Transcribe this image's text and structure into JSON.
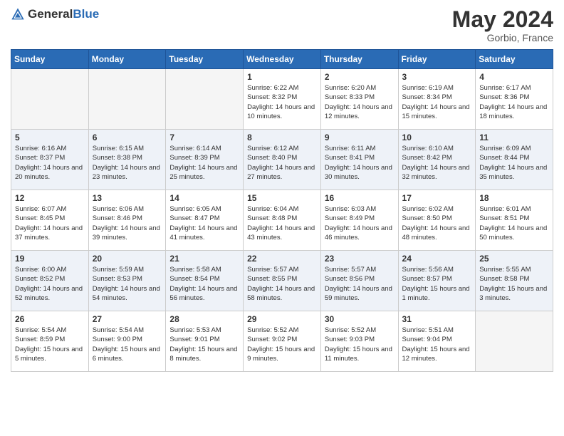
{
  "header": {
    "logo_general": "General",
    "logo_blue": "Blue",
    "month_year": "May 2024",
    "location": "Gorbio, France"
  },
  "days_of_week": [
    "Sunday",
    "Monday",
    "Tuesday",
    "Wednesday",
    "Thursday",
    "Friday",
    "Saturday"
  ],
  "weeks": [
    [
      {
        "day": "",
        "empty": true
      },
      {
        "day": "",
        "empty": true
      },
      {
        "day": "",
        "empty": true
      },
      {
        "day": "1",
        "sunrise": "6:22 AM",
        "sunset": "8:32 PM",
        "daylight": "14 hours and 10 minutes."
      },
      {
        "day": "2",
        "sunrise": "6:20 AM",
        "sunset": "8:33 PM",
        "daylight": "14 hours and 12 minutes."
      },
      {
        "day": "3",
        "sunrise": "6:19 AM",
        "sunset": "8:34 PM",
        "daylight": "14 hours and 15 minutes."
      },
      {
        "day": "4",
        "sunrise": "6:17 AM",
        "sunset": "8:36 PM",
        "daylight": "14 hours and 18 minutes."
      }
    ],
    [
      {
        "day": "5",
        "sunrise": "6:16 AM",
        "sunset": "8:37 PM",
        "daylight": "14 hours and 20 minutes."
      },
      {
        "day": "6",
        "sunrise": "6:15 AM",
        "sunset": "8:38 PM",
        "daylight": "14 hours and 23 minutes."
      },
      {
        "day": "7",
        "sunrise": "6:14 AM",
        "sunset": "8:39 PM",
        "daylight": "14 hours and 25 minutes."
      },
      {
        "day": "8",
        "sunrise": "6:12 AM",
        "sunset": "8:40 PM",
        "daylight": "14 hours and 27 minutes."
      },
      {
        "day": "9",
        "sunrise": "6:11 AM",
        "sunset": "8:41 PM",
        "daylight": "14 hours and 30 minutes."
      },
      {
        "day": "10",
        "sunrise": "6:10 AM",
        "sunset": "8:42 PM",
        "daylight": "14 hours and 32 minutes."
      },
      {
        "day": "11",
        "sunrise": "6:09 AM",
        "sunset": "8:44 PM",
        "daylight": "14 hours and 35 minutes."
      }
    ],
    [
      {
        "day": "12",
        "sunrise": "6:07 AM",
        "sunset": "8:45 PM",
        "daylight": "14 hours and 37 minutes."
      },
      {
        "day": "13",
        "sunrise": "6:06 AM",
        "sunset": "8:46 PM",
        "daylight": "14 hours and 39 minutes."
      },
      {
        "day": "14",
        "sunrise": "6:05 AM",
        "sunset": "8:47 PM",
        "daylight": "14 hours and 41 minutes."
      },
      {
        "day": "15",
        "sunrise": "6:04 AM",
        "sunset": "8:48 PM",
        "daylight": "14 hours and 43 minutes."
      },
      {
        "day": "16",
        "sunrise": "6:03 AM",
        "sunset": "8:49 PM",
        "daylight": "14 hours and 46 minutes."
      },
      {
        "day": "17",
        "sunrise": "6:02 AM",
        "sunset": "8:50 PM",
        "daylight": "14 hours and 48 minutes."
      },
      {
        "day": "18",
        "sunrise": "6:01 AM",
        "sunset": "8:51 PM",
        "daylight": "14 hours and 50 minutes."
      }
    ],
    [
      {
        "day": "19",
        "sunrise": "6:00 AM",
        "sunset": "8:52 PM",
        "daylight": "14 hours and 52 minutes."
      },
      {
        "day": "20",
        "sunrise": "5:59 AM",
        "sunset": "8:53 PM",
        "daylight": "14 hours and 54 minutes."
      },
      {
        "day": "21",
        "sunrise": "5:58 AM",
        "sunset": "8:54 PM",
        "daylight": "14 hours and 56 minutes."
      },
      {
        "day": "22",
        "sunrise": "5:57 AM",
        "sunset": "8:55 PM",
        "daylight": "14 hours and 58 minutes."
      },
      {
        "day": "23",
        "sunrise": "5:57 AM",
        "sunset": "8:56 PM",
        "daylight": "14 hours and 59 minutes."
      },
      {
        "day": "24",
        "sunrise": "5:56 AM",
        "sunset": "8:57 PM",
        "daylight": "15 hours and 1 minute."
      },
      {
        "day": "25",
        "sunrise": "5:55 AM",
        "sunset": "8:58 PM",
        "daylight": "15 hours and 3 minutes."
      }
    ],
    [
      {
        "day": "26",
        "sunrise": "5:54 AM",
        "sunset": "8:59 PM",
        "daylight": "15 hours and 5 minutes."
      },
      {
        "day": "27",
        "sunrise": "5:54 AM",
        "sunset": "9:00 PM",
        "daylight": "15 hours and 6 minutes."
      },
      {
        "day": "28",
        "sunrise": "5:53 AM",
        "sunset": "9:01 PM",
        "daylight": "15 hours and 8 minutes."
      },
      {
        "day": "29",
        "sunrise": "5:52 AM",
        "sunset": "9:02 PM",
        "daylight": "15 hours and 9 minutes."
      },
      {
        "day": "30",
        "sunrise": "5:52 AM",
        "sunset": "9:03 PM",
        "daylight": "15 hours and 11 minutes."
      },
      {
        "day": "31",
        "sunrise": "5:51 AM",
        "sunset": "9:04 PM",
        "daylight": "15 hours and 12 minutes."
      },
      {
        "day": "",
        "empty": true
      }
    ]
  ]
}
